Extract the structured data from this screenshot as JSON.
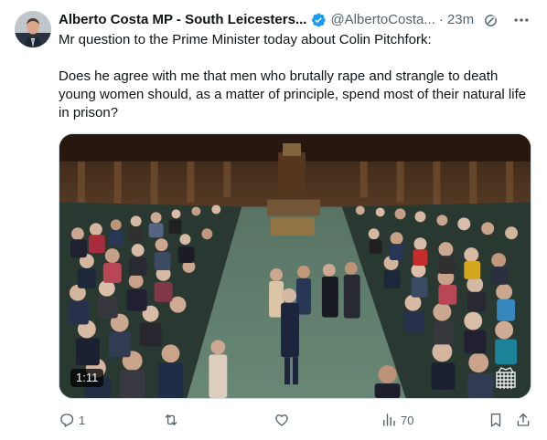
{
  "tweet": {
    "author": {
      "display_name": "Alberto Costa MP - South Leicesters...",
      "handle": "@AlbertoCosta...",
      "verified_icon": "verified-badge-icon",
      "avatar": "avatar"
    },
    "separator": "·",
    "time": "23m",
    "edited_icon": "edit-history-icon",
    "more_icon": "more-options-icon",
    "text_lines": [
      "Mr question to the Prime Minister today about Colin Pitchfork:",
      "Does he agree with me that men who brutally rape and strangle to death young women should, as a matter of principle, spend most of their natural life in prison?"
    ],
    "media": {
      "duration": "1:11",
      "watermark_icon": "portcullis-icon"
    },
    "actions": {
      "replies": "1",
      "reposts": "",
      "likes": "",
      "views": "70"
    }
  },
  "colors": {
    "text_primary": "#0f1419",
    "text_secondary": "#536471",
    "verified_blue": "#1d9bf0",
    "border": "#cfd9de"
  }
}
